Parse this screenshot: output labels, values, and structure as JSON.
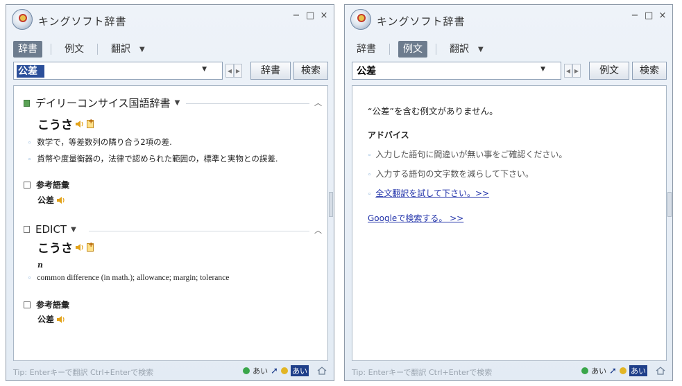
{
  "left": {
    "title": "キングソフト辞書",
    "window_controls": [
      "−",
      "□",
      "×"
    ],
    "tabs": [
      {
        "label": "辞書",
        "active": true
      },
      {
        "label": "例文",
        "active": false
      },
      {
        "label": "翻訳",
        "active": false
      }
    ],
    "search_value": "公差",
    "btn1": "辞書",
    "btn2": "検索",
    "dict1": {
      "name": "デイリーコンサイス国語辞書",
      "reading": "こうさ",
      "defs": [
        "数学で，等差数列の隣り合う2項の差.",
        "貨幣や度量衡器の，法律で認められた範囲の，標準と実物との誤差."
      ],
      "ref_label": "参考語彙",
      "ref_word": "公差"
    },
    "dict2": {
      "name": "EDICT",
      "reading": "こうさ",
      "pos": "n",
      "def": "common difference (in math.); allowance; margin; tolerance",
      "ref_label": "参考語彙",
      "ref_word": "公差"
    },
    "tip": "Tip: Enterキーで翻訳  Ctrl+Enterで検索",
    "ime1": "あい",
    "ime2": "あい"
  },
  "right": {
    "title": "キングソフト辞書",
    "window_controls": [
      "−",
      "□",
      "×"
    ],
    "tabs": [
      {
        "label": "辞書",
        "active": false
      },
      {
        "label": "例文",
        "active": true
      },
      {
        "label": "翻訳",
        "active": false
      }
    ],
    "search_value": "公差",
    "btn1": "例文",
    "btn2": "検索",
    "message": "“公差”を含む例文がありません。",
    "advice_title": "アドバイス",
    "advice": [
      "入力した語句に間違いが無い事をご確認ください。",
      "入力する語句の文字数を減らして下さい。"
    ],
    "fulltext_link": "全文翻訳を試して下さい。>>",
    "google_link": "Googleで検索する。 >>",
    "tip": "Tip: Enterキーで翻訳  Ctrl+Enterで検索",
    "ime1": "あい",
    "ime2": "あい"
  },
  "colors": {
    "accent_tab": "#6d7c8e",
    "link": "#2233aa",
    "bullet": "#3a7fc1"
  }
}
